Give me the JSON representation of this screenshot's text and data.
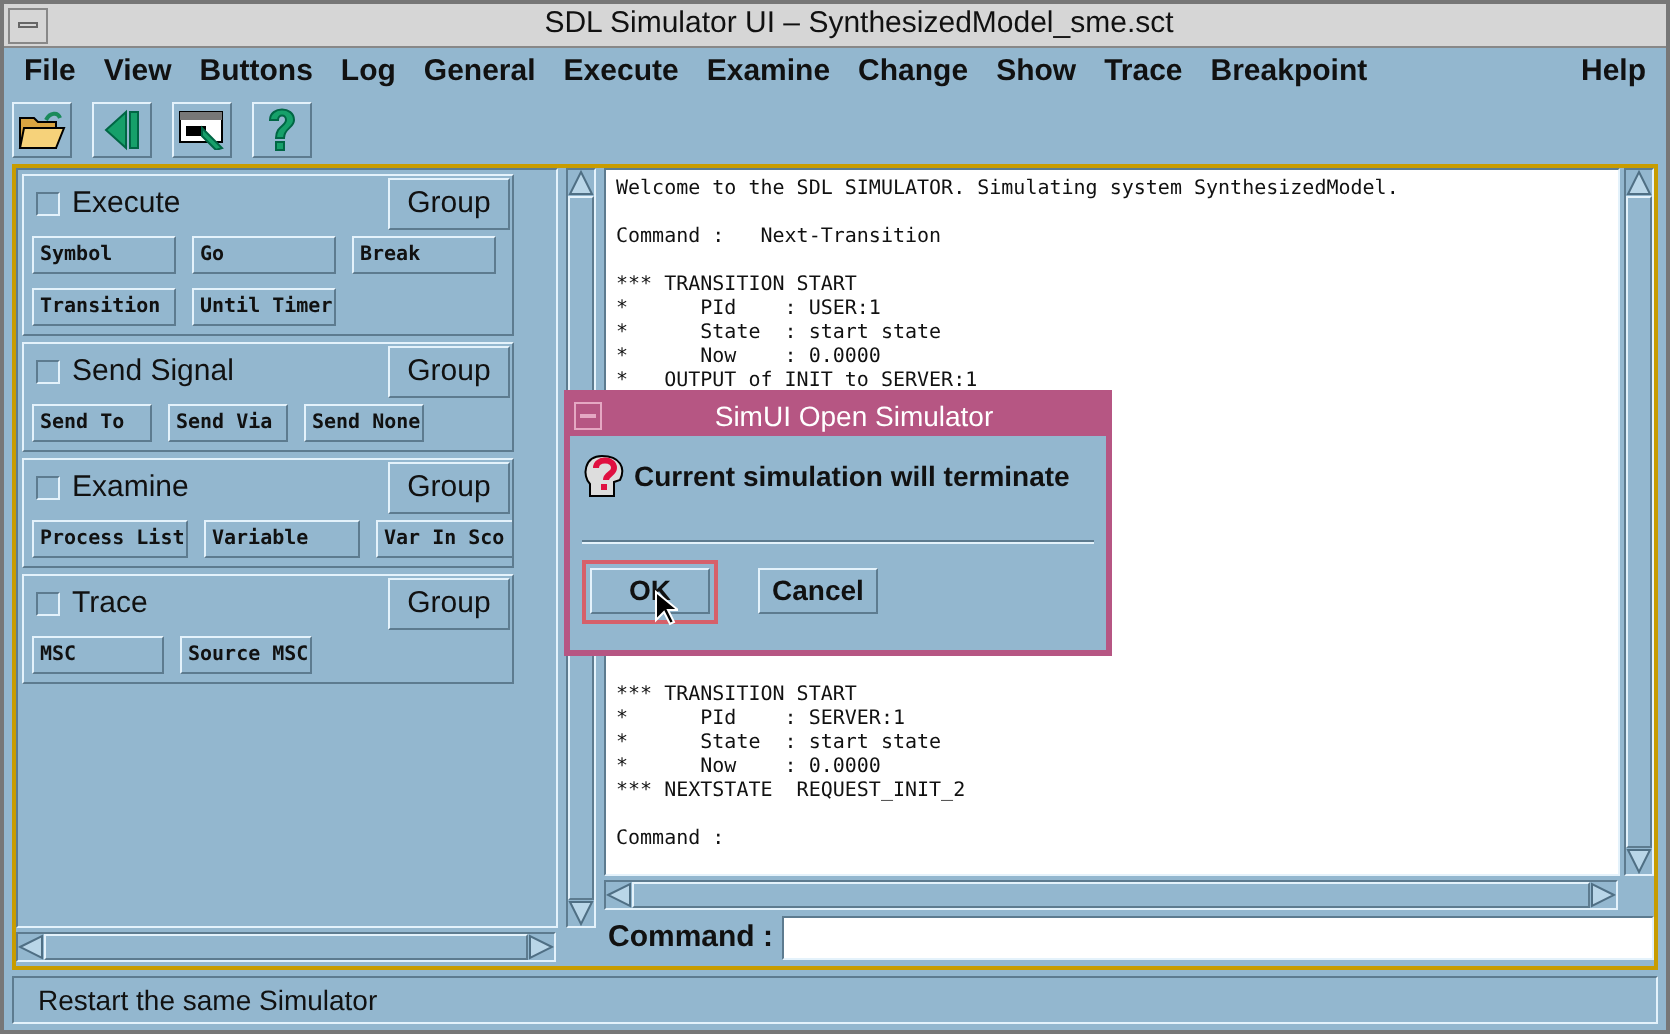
{
  "window": {
    "title": "SDL Simulator UI – SynthesizedModel_sme.sct"
  },
  "menu": [
    {
      "label": "File"
    },
    {
      "label": "View"
    },
    {
      "label": "Buttons"
    },
    {
      "label": "Log"
    },
    {
      "label": "General"
    },
    {
      "label": "Execute"
    },
    {
      "label": "Examine"
    },
    {
      "label": "Change"
    },
    {
      "label": "Show"
    },
    {
      "label": "Trace"
    },
    {
      "label": "Breakpoint"
    },
    {
      "label": "Help"
    }
  ],
  "toolbar": [
    {
      "kind": "open"
    },
    {
      "kind": "restart"
    },
    {
      "kind": "window"
    },
    {
      "kind": "help"
    }
  ],
  "groups": [
    {
      "title": "Execute",
      "checked": false,
      "group_button": "Group",
      "buttons": [
        "Symbol",
        "Go",
        "Break",
        "Transition",
        "Until Timer"
      ]
    },
    {
      "title": "Send Signal",
      "checked": false,
      "group_button": "Group",
      "buttons": [
        "Send To",
        "Send Via",
        "Send None"
      ]
    },
    {
      "title": "Examine",
      "checked": false,
      "group_button": "Group",
      "buttons": [
        "Process List",
        "Variable",
        "Var In Sco"
      ]
    },
    {
      "title": "Trace",
      "checked": false,
      "group_button": "Group",
      "buttons": [
        "MSC",
        "Source MSC"
      ]
    }
  ],
  "console": {
    "blocks_top": [
      [
        "Welcome to the SDL SIMULATOR. Simulating system SynthesizedModel."
      ],
      [
        "Command :   Next-Transition"
      ],
      [
        "*** TRANSITION START",
        "*      PId    : USER:1",
        "*      State  : start state",
        "*      Now    : 0.0000",
        "*   OUTPUT of INIT to SERVER:1"
      ]
    ],
    "blocks_bottom": [
      [
        "*** TRANSITION START",
        "*      PId    : SERVER:1",
        "*      State  : start state",
        "*      Now    : 0.0000",
        "*** NEXTSTATE  REQUEST_INIT_2"
      ],
      [
        "Command :"
      ]
    ]
  },
  "command": {
    "label": "Command :"
  },
  "status_bar": {
    "text": "Restart the same Simulator"
  },
  "dialog": {
    "title": "SimUI Open Simulator",
    "message": "Current simulation will terminate",
    "buttons": [
      {
        "label": "OK",
        "focused": true
      },
      {
        "label": "Cancel",
        "focused": false
      }
    ]
  }
}
